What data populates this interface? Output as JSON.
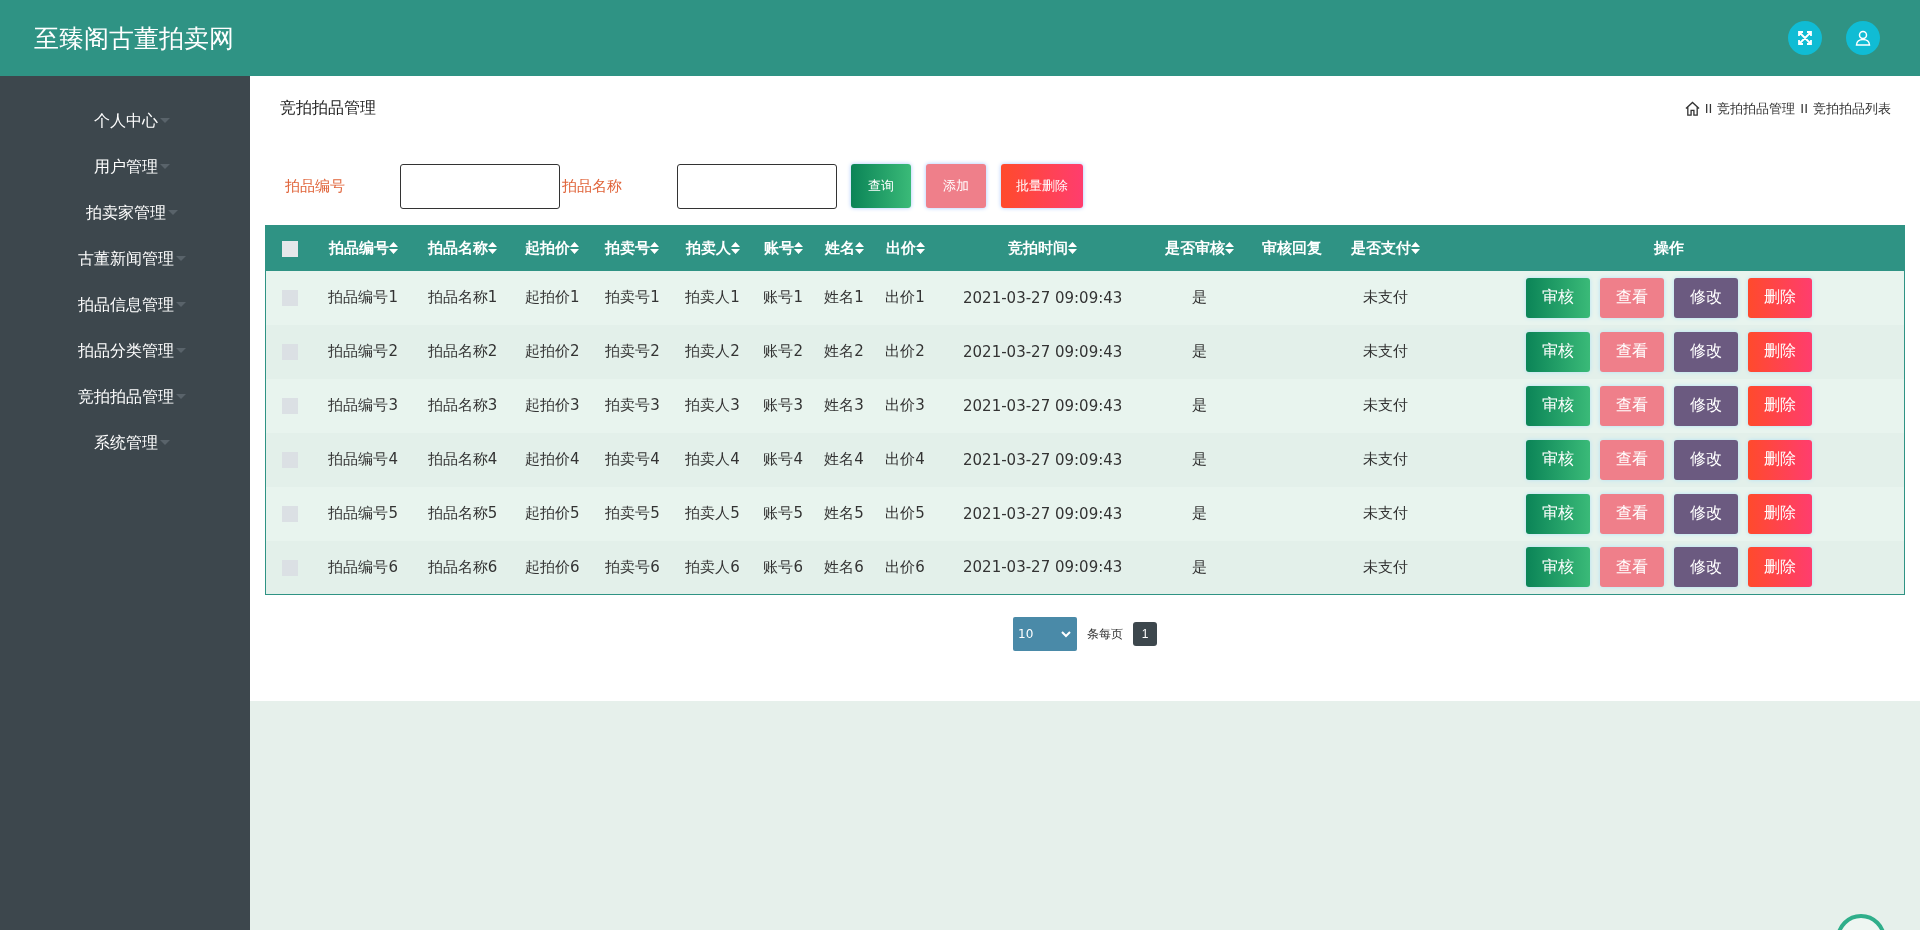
{
  "header": {
    "title": "至臻阁古董拍卖网"
  },
  "sidebar": {
    "items": [
      {
        "label": "个人中心"
      },
      {
        "label": "用户管理"
      },
      {
        "label": "拍卖家管理"
      },
      {
        "label": "古董新闻管理"
      },
      {
        "label": "拍品信息管理"
      },
      {
        "label": "拍品分类管理"
      },
      {
        "label": "竞拍拍品管理"
      },
      {
        "label": "系统管理"
      }
    ]
  },
  "page": {
    "title": "竞拍拍品管理",
    "breadcrumb": [
      {
        "separator": "II",
        "label": "竞拍拍品管理"
      },
      {
        "separator": "II",
        "label": "竞拍拍品列表"
      }
    ]
  },
  "search": {
    "fields": [
      {
        "label": "拍品编号"
      },
      {
        "label": "拍品名称"
      }
    ],
    "buttons": [
      {
        "kind": "query",
        "label": "查询"
      },
      {
        "kind": "add",
        "label": "添加"
      },
      {
        "kind": "delete",
        "label": "批量删除"
      }
    ]
  },
  "table": {
    "select_all": {
      "checked": false
    },
    "columns": [
      {
        "label": "拍品编号",
        "sortable": true
      },
      {
        "label": "拍品名称",
        "sortable": true
      },
      {
        "label": "起拍价",
        "sortable": true
      },
      {
        "label": "拍卖号",
        "sortable": true
      },
      {
        "label": "拍卖人",
        "sortable": true
      },
      {
        "label": "账号",
        "sortable": true
      },
      {
        "label": "姓名",
        "sortable": true
      },
      {
        "label": "出价",
        "sortable": true
      },
      {
        "label": "竞拍时间",
        "sortable": true
      },
      {
        "label": "是否审核",
        "sortable": true
      },
      {
        "label": "审核回复",
        "sortable": false
      },
      {
        "label": "是否支付",
        "sortable": true
      },
      {
        "label": "操作",
        "sortable": false
      }
    ],
    "rows": [
      {
        "checked": false,
        "cells": [
          "拍品编号1",
          "拍品名称1",
          "起拍价1",
          "拍卖号1",
          "拍卖人1",
          "账号1",
          "姓名1",
          "出价1",
          "2021-03-27 09:09:43",
          "是",
          "",
          "未支付"
        ],
        "actions": [
          {
            "kind": "review",
            "label": "审核"
          },
          {
            "kind": "view",
            "label": "查看"
          },
          {
            "kind": "edit",
            "label": "修改"
          },
          {
            "kind": "delete",
            "label": "删除"
          }
        ]
      },
      {
        "checked": false,
        "cells": [
          "拍品编号2",
          "拍品名称2",
          "起拍价2",
          "拍卖号2",
          "拍卖人2",
          "账号2",
          "姓名2",
          "出价2",
          "2021-03-27 09:09:43",
          "是",
          "",
          "未支付"
        ],
        "actions": [
          {
            "kind": "review",
            "label": "审核"
          },
          {
            "kind": "view",
            "label": "查看"
          },
          {
            "kind": "edit",
            "label": "修改"
          },
          {
            "kind": "delete",
            "label": "删除"
          }
        ]
      },
      {
        "checked": false,
        "cells": [
          "拍品编号3",
          "拍品名称3",
          "起拍价3",
          "拍卖号3",
          "拍卖人3",
          "账号3",
          "姓名3",
          "出价3",
          "2021-03-27 09:09:43",
          "是",
          "",
          "未支付"
        ],
        "actions": [
          {
            "kind": "review",
            "label": "审核"
          },
          {
            "kind": "view",
            "label": "查看"
          },
          {
            "kind": "edit",
            "label": "修改"
          },
          {
            "kind": "delete",
            "label": "删除"
          }
        ]
      },
      {
        "checked": false,
        "cells": [
          "拍品编号4",
          "拍品名称4",
          "起拍价4",
          "拍卖号4",
          "拍卖人4",
          "账号4",
          "姓名4",
          "出价4",
          "2021-03-27 09:09:43",
          "是",
          "",
          "未支付"
        ],
        "actions": [
          {
            "kind": "review",
            "label": "审核"
          },
          {
            "kind": "view",
            "label": "查看"
          },
          {
            "kind": "edit",
            "label": "修改"
          },
          {
            "kind": "delete",
            "label": "删除"
          }
        ]
      },
      {
        "checked": false,
        "cells": [
          "拍品编号5",
          "拍品名称5",
          "起拍价5",
          "拍卖号5",
          "拍卖人5",
          "账号5",
          "姓名5",
          "出价5",
          "2021-03-27 09:09:43",
          "是",
          "",
          "未支付"
        ],
        "actions": [
          {
            "kind": "review",
            "label": "审核"
          },
          {
            "kind": "view",
            "label": "查看"
          },
          {
            "kind": "edit",
            "label": "修改"
          },
          {
            "kind": "delete",
            "label": "删除"
          }
        ]
      },
      {
        "checked": false,
        "cells": [
          "拍品编号6",
          "拍品名称6",
          "起拍价6",
          "拍卖号6",
          "拍卖人6",
          "账号6",
          "姓名6",
          "出价6",
          "2021-03-27 09:09:43",
          "是",
          "",
          "未支付"
        ],
        "actions": [
          {
            "kind": "review",
            "label": "审核"
          },
          {
            "kind": "view",
            "label": "查看"
          },
          {
            "kind": "edit",
            "label": "修改"
          },
          {
            "kind": "delete",
            "label": "删除"
          }
        ]
      }
    ]
  },
  "pagination": {
    "page_size": "10",
    "per_page_label": "条每页",
    "pages": [
      {
        "label": "1",
        "selected": true
      }
    ]
  }
}
